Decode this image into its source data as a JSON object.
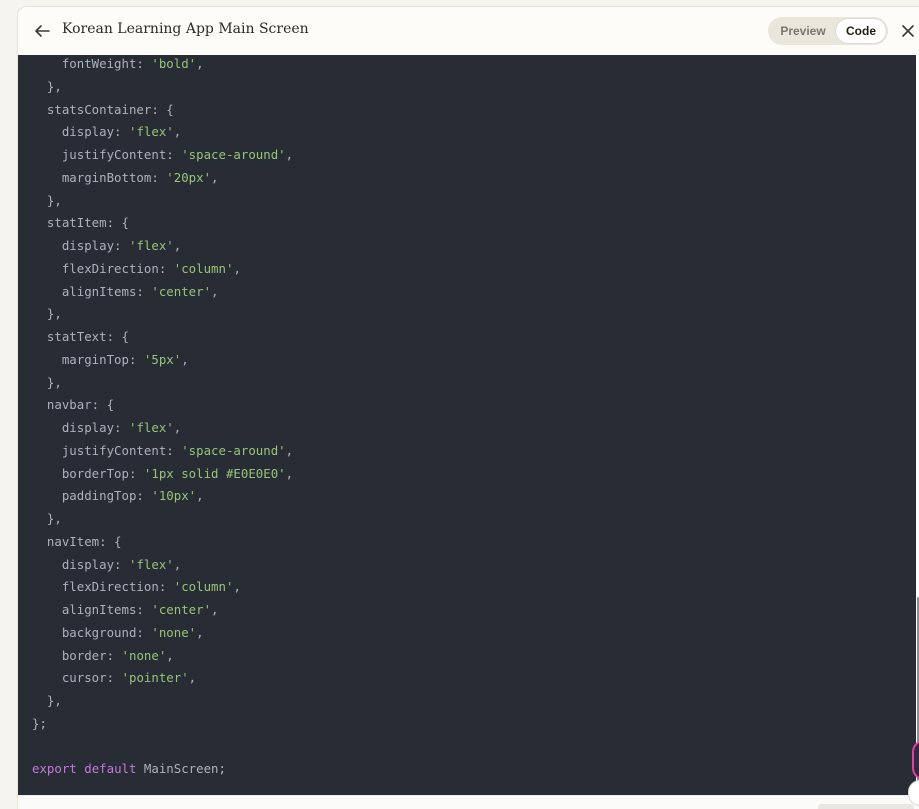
{
  "header": {
    "title": "Korean Learning App Main Screen",
    "tabs": [
      {
        "label": "Preview",
        "active": false
      },
      {
        "label": "Code",
        "active": true
      }
    ],
    "back_icon": "arrow-left-icon",
    "close_icon": "close-icon"
  },
  "colors": {
    "code_background": "#282c34",
    "string": "#98c379",
    "keyword": "#c678dd",
    "plain": "#abb2bf"
  },
  "code": [
    [
      {
        "t": "    fontWeight: ",
        "c": "key"
      },
      {
        "t": "'bold'",
        "c": "str"
      },
      {
        "t": ",",
        "c": "key"
      }
    ],
    [
      {
        "t": "  },",
        "c": "key"
      }
    ],
    [
      {
        "t": "  statsContainer: {",
        "c": "key"
      }
    ],
    [
      {
        "t": "    display: ",
        "c": "key"
      },
      {
        "t": "'flex'",
        "c": "str"
      },
      {
        "t": ",",
        "c": "key"
      }
    ],
    [
      {
        "t": "    justifyContent: ",
        "c": "key"
      },
      {
        "t": "'space-around'",
        "c": "str"
      },
      {
        "t": ",",
        "c": "key"
      }
    ],
    [
      {
        "t": "    marginBottom: ",
        "c": "key"
      },
      {
        "t": "'20px'",
        "c": "str"
      },
      {
        "t": ",",
        "c": "key"
      }
    ],
    [
      {
        "t": "  },",
        "c": "key"
      }
    ],
    [
      {
        "t": "  statItem: {",
        "c": "key"
      }
    ],
    [
      {
        "t": "    display: ",
        "c": "key"
      },
      {
        "t": "'flex'",
        "c": "str"
      },
      {
        "t": ",",
        "c": "key"
      }
    ],
    [
      {
        "t": "    flexDirection: ",
        "c": "key"
      },
      {
        "t": "'column'",
        "c": "str"
      },
      {
        "t": ",",
        "c": "key"
      }
    ],
    [
      {
        "t": "    alignItems: ",
        "c": "key"
      },
      {
        "t": "'center'",
        "c": "str"
      },
      {
        "t": ",",
        "c": "key"
      }
    ],
    [
      {
        "t": "  },",
        "c": "key"
      }
    ],
    [
      {
        "t": "  statText: {",
        "c": "key"
      }
    ],
    [
      {
        "t": "    marginTop: ",
        "c": "key"
      },
      {
        "t": "'5px'",
        "c": "str"
      },
      {
        "t": ",",
        "c": "key"
      }
    ],
    [
      {
        "t": "  },",
        "c": "key"
      }
    ],
    [
      {
        "t": "  navbar: {",
        "c": "key"
      }
    ],
    [
      {
        "t": "    display: ",
        "c": "key"
      },
      {
        "t": "'flex'",
        "c": "str"
      },
      {
        "t": ",",
        "c": "key"
      }
    ],
    [
      {
        "t": "    justifyContent: ",
        "c": "key"
      },
      {
        "t": "'space-around'",
        "c": "str"
      },
      {
        "t": ",",
        "c": "key"
      }
    ],
    [
      {
        "t": "    borderTop: ",
        "c": "key"
      },
      {
        "t": "'1px solid #E0E0E0'",
        "c": "str"
      },
      {
        "t": ",",
        "c": "key"
      }
    ],
    [
      {
        "t": "    paddingTop: ",
        "c": "key"
      },
      {
        "t": "'10px'",
        "c": "str"
      },
      {
        "t": ",",
        "c": "key"
      }
    ],
    [
      {
        "t": "  },",
        "c": "key"
      }
    ],
    [
      {
        "t": "  navItem: {",
        "c": "key"
      }
    ],
    [
      {
        "t": "    display: ",
        "c": "key"
      },
      {
        "t": "'flex'",
        "c": "str"
      },
      {
        "t": ",",
        "c": "key"
      }
    ],
    [
      {
        "t": "    flexDirection: ",
        "c": "key"
      },
      {
        "t": "'column'",
        "c": "str"
      },
      {
        "t": ",",
        "c": "key"
      }
    ],
    [
      {
        "t": "    alignItems: ",
        "c": "key"
      },
      {
        "t": "'center'",
        "c": "str"
      },
      {
        "t": ",",
        "c": "key"
      }
    ],
    [
      {
        "t": "    background: ",
        "c": "key"
      },
      {
        "t": "'none'",
        "c": "str"
      },
      {
        "t": ",",
        "c": "key"
      }
    ],
    [
      {
        "t": "    border: ",
        "c": "key"
      },
      {
        "t": "'none'",
        "c": "str"
      },
      {
        "t": ",",
        "c": "key"
      }
    ],
    [
      {
        "t": "    cursor: ",
        "c": "key"
      },
      {
        "t": "'pointer'",
        "c": "str"
      },
      {
        "t": ",",
        "c": "key"
      }
    ],
    [
      {
        "t": "  },",
        "c": "key"
      }
    ],
    [
      {
        "t": "};",
        "c": "key"
      }
    ],
    [
      {
        "t": "",
        "c": "key"
      }
    ],
    [
      {
        "t": "export",
        "c": "kw"
      },
      {
        "t": " ",
        "c": "key"
      },
      {
        "t": "default",
        "c": "kw"
      },
      {
        "t": " MainScreen;",
        "c": "id"
      }
    ]
  ]
}
